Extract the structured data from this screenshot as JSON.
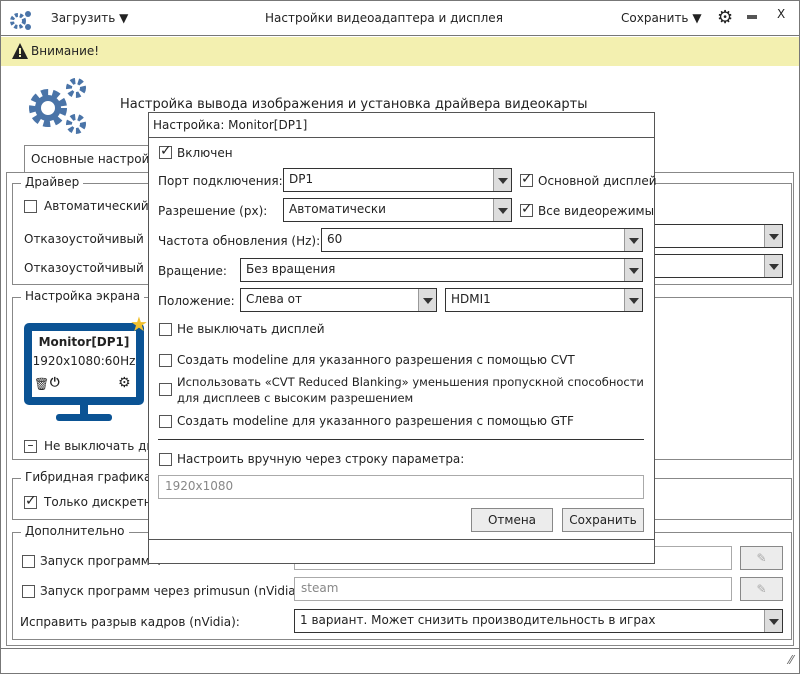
{
  "titlebar": {
    "load_label": "Загрузить",
    "title": "Настройки видеоадаптера и дисплея",
    "save_label": "Сохранить",
    "close": "X"
  },
  "warning": {
    "text": "Внимание!"
  },
  "header": {
    "subtitle": "Настройка вывода изображения и установка драйвера видеокарты"
  },
  "tabs": [
    {
      "label": "Основные настройки"
    }
  ],
  "driver": {
    "title": "Драйвер",
    "auto_label": "Автоматический в",
    "failsafe1": "Отказоустойчивый др",
    "failsafe2": "Отказоустойчивый др"
  },
  "screen": {
    "title": "Настройка экрана",
    "monitor_name": "Monitor[DP1]",
    "monitor_mode": "1920x1080:60Hz",
    "keep_on_label": "Не выключать ди"
  },
  "hybrid": {
    "title": "Гибридная графика",
    "discrete_label": "Только дискретно"
  },
  "extra": {
    "title": "Дополнительно",
    "run1_label": "Запуск программ ч",
    "run2_label": "Запуск программ через primusun (nVidia):",
    "run2_value": "steam",
    "tearing_label": "Исправить разрыв кадров (nVidia):",
    "tearing_value": "1 вариант. Может снизить производительность в играх"
  },
  "dialog": {
    "title": "Настройка: Monitor[DP1]",
    "enabled": "Включен",
    "port_label": "Порт подключения:",
    "port_value": "DP1",
    "primary_label": "Основной дисплей",
    "res_label": "Разрешение (px):",
    "res_value": "Автоматически",
    "allmodes_label": "Все видеорежимы",
    "rate_label": "Частота обновления (Hz):",
    "rate_value": "60",
    "rot_label": "Вращение:",
    "rot_value": "Без вращения",
    "pos_label": "Положение:",
    "pos_value": "Слева от",
    "pos_target": "HDMI1",
    "opt1": "Не выключать дисплей",
    "opt2": "Создать modeline для указанного разрешения с помощью CVT",
    "opt3a": "Использовать «CVT Reduced Blanking» уменьшения пропускной способности",
    "opt3b": "для дисплеев с высоким разрешением",
    "opt4": "Создать modeline для указанного разрешения с помощью GTF",
    "manual_label": "Настроить вручную через строку параметра:",
    "manual_placeholder": "1920x1080",
    "cancel": "Отмена",
    "save": "Сохранить"
  },
  "colors": {
    "accent": "#0b5394",
    "gear": "#4a74a8",
    "warning_bg": "#f3f0b0",
    "star": "#f0c030"
  }
}
